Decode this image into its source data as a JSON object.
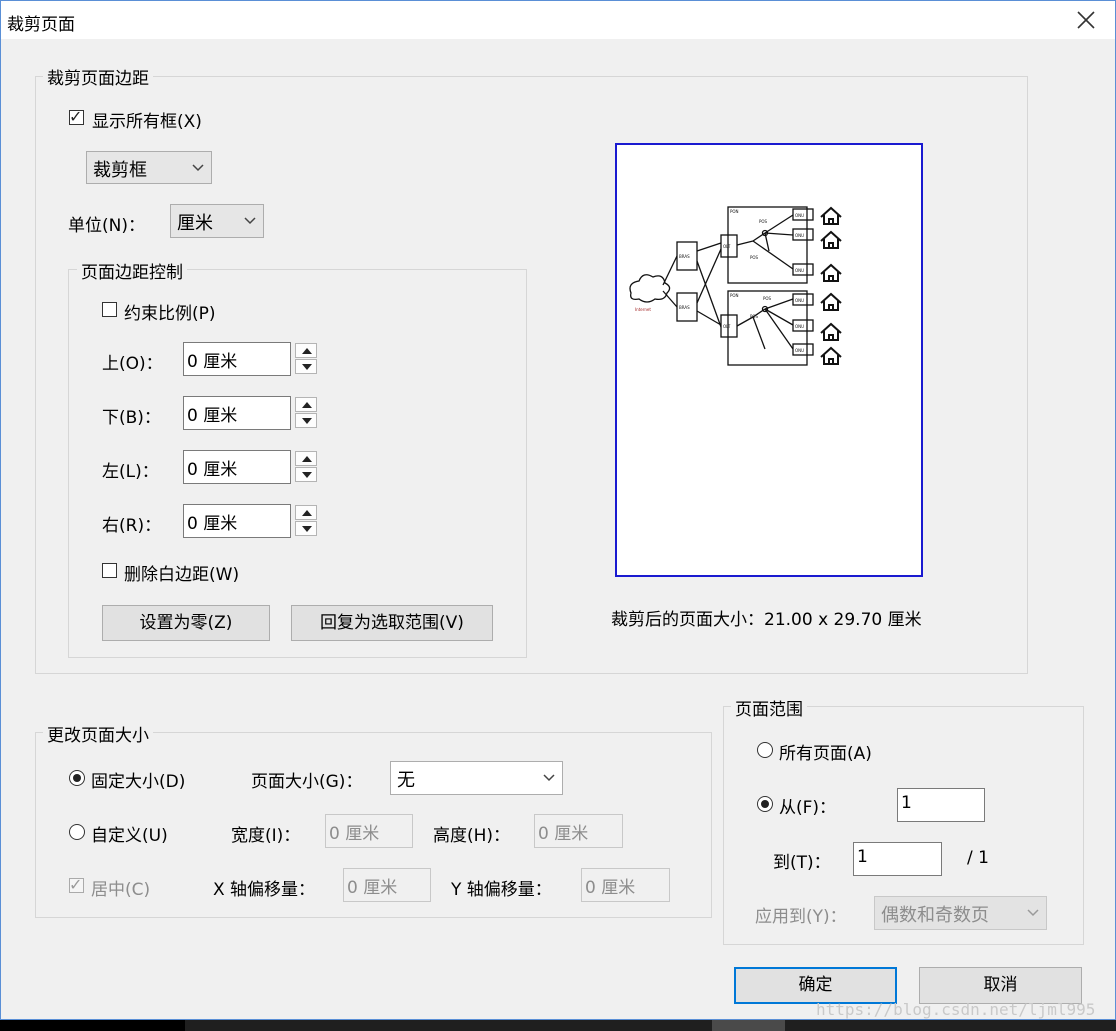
{
  "title": "裁剪页面",
  "margins_group": {
    "legend": "裁剪页面边距",
    "show_all_boxes": {
      "label": "显示所有框(X)",
      "checked": true
    },
    "box_select": "裁剪框",
    "unit_label": "单位(N)：",
    "unit_value": "厘米",
    "control_group": {
      "legend": "页面边距控制",
      "constrain": {
        "label": "约束比例(P)",
        "checked": false
      },
      "top": {
        "label": "上(O)：",
        "value": "0 厘米"
      },
      "bottom": {
        "label": "下(B)：",
        "value": "0 厘米"
      },
      "left": {
        "label": "左(L)：",
        "value": "0 厘米"
      },
      "right": {
        "label": "右(R)：",
        "value": "0 厘米"
      },
      "remove_white": {
        "label": "删除白边距(W)",
        "checked": false
      },
      "set_zero": "设置为零(Z)",
      "revert": "回复为选取范围(V)"
    },
    "preview": {
      "size_text": "裁剪后的页面大小：21.00 x 29.70 厘米",
      "labels": {
        "bras": "BRAS",
        "olt": "OLT",
        "onu": "ONU",
        "pon": "PON",
        "pos": "POS",
        "internet": "Internet"
      }
    }
  },
  "resize_group": {
    "legend": "更改页面大小",
    "fixed": {
      "label": "固定大小(D)",
      "selected": true
    },
    "page_size_label": "页面大小(G)：",
    "page_size_value": "无",
    "custom": {
      "label": "自定义(U)",
      "selected": false
    },
    "width_label": "宽度(I)：",
    "width_value": "0 厘米",
    "height_label": "高度(H)：",
    "height_value": "0 厘米",
    "center": {
      "label": "居中(C)",
      "checked": true
    },
    "x_offset_label": "X 轴偏移量：",
    "x_offset_value": "0 厘米",
    "y_offset_label": "Y 轴偏移量：",
    "y_offset_value": "0 厘米"
  },
  "range_group": {
    "legend": "页面范围",
    "all": {
      "label": "所有页面(A)",
      "selected": false
    },
    "from": {
      "label": "从(F)：",
      "value": "1",
      "selected": true
    },
    "to_label": "到(T)：",
    "to_value": "1",
    "of_total": "/ 1",
    "apply_label": "应用到(Y)：",
    "apply_value": "偶数和奇数页"
  },
  "ok": "确定",
  "cancel": "取消",
  "watermark": "https://blog.csdn.net/ljml995"
}
